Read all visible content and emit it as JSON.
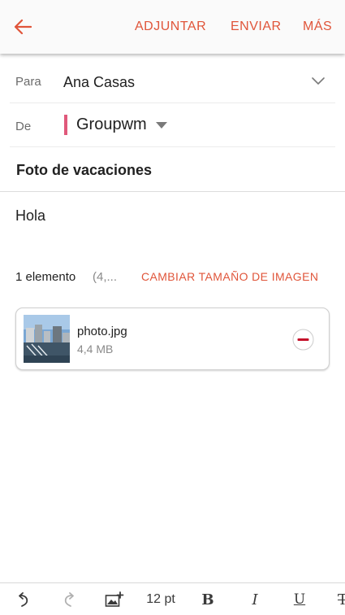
{
  "header": {
    "back_icon": "arrow-left-icon",
    "actions": {
      "attach": "ADJUNTAR",
      "send": "ENVIAR",
      "more": "MÁS"
    },
    "accent_color": "#e0553a"
  },
  "compose": {
    "to": {
      "label": "Para",
      "value": "Ana Casas",
      "expand_icon": "chevron-down-icon"
    },
    "from": {
      "label": "De",
      "value": "Groupwm",
      "account_color": "#e0597b",
      "dropdown_icon": "caret-down-icon"
    },
    "subject": "Foto de vacaciones",
    "body": "Hola"
  },
  "attachments": {
    "count_text": "1 elemento",
    "total_size_text": "(4,...",
    "resize_action": "CAMBIAR TAMAÑO DE IMAGEN",
    "items": [
      {
        "name": "photo.jpg",
        "size": "4,4 MB",
        "thumb_icon": "photo-thumbnail",
        "remove_icon": "remove-circle-icon"
      }
    ]
  },
  "toolbar": {
    "undo_icon": "undo-icon",
    "redo_icon": "redo-icon",
    "insert_image_icon": "insert-image-icon",
    "font_size": "12 pt",
    "bold": "B",
    "italic": "I",
    "underline": "U",
    "strikethrough": "T"
  }
}
